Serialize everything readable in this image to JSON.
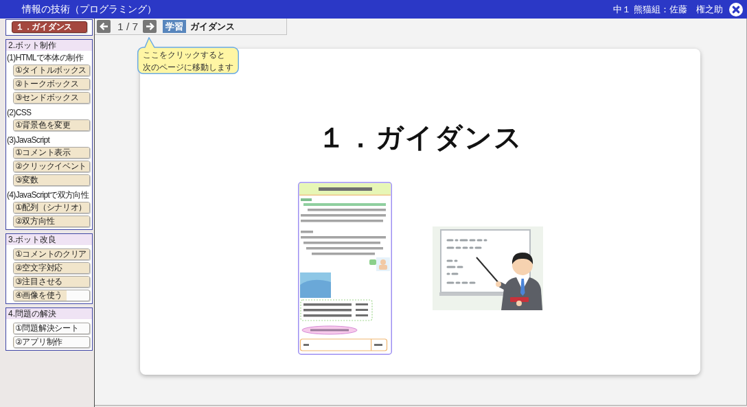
{
  "header": {
    "title": "情報の技術（プログラミング）",
    "user": "中１ 熊猫組：佐藤　権之助"
  },
  "sidebar": {
    "sections": [
      {
        "groups": [
          {
            "lessons": [
              {
                "label": "１．ガイダンス",
                "selected": true
              }
            ]
          }
        ]
      },
      {
        "title": "2.ボット制作",
        "groups": [
          {
            "label": "(1)HTMLで本体の制作",
            "lessons": [
              {
                "label": "①タイトルボックス",
                "selected": false,
                "level": 1
              },
              {
                "label": "②トークボックス",
                "selected": false,
                "level": 1
              },
              {
                "label": "③センドボックス",
                "selected": false,
                "level": 1
              }
            ]
          },
          {
            "label": "(2)CSS",
            "lessons": [
              {
                "label": "①背景色を変更",
                "selected": false,
                "level": 1
              }
            ]
          },
          {
            "label": "(3)JavaScript",
            "lessons": [
              {
                "label": "①コメント表示",
                "selected": false,
                "level": 1
              },
              {
                "label": "②クリックイベント",
                "selected": false,
                "level": 1
              },
              {
                "label": "③変数",
                "selected": false,
                "level": 1
              }
            ]
          },
          {
            "label": "(4)JavaScriptで双方向性",
            "lessons": [
              {
                "label": "①配列（シナリオ）",
                "selected": false,
                "level": 1
              },
              {
                "label": "②双方向性",
                "selected": false,
                "level": 1
              }
            ]
          }
        ]
      },
      {
        "title": "3.ボット改良",
        "groups": [
          {
            "lessons": [
              {
                "label": "①コメントのクリア",
                "selected": false,
                "level": 1
              },
              {
                "label": "②空文字対応",
                "selected": false,
                "level": 1
              },
              {
                "label": "③注目させる",
                "selected": false,
                "level": 1
              },
              {
                "label": "④画像を使う",
                "selected": false,
                "level": 0.7
              }
            ]
          }
        ]
      },
      {
        "title": "4.問題の解決",
        "groups": [
          {
            "lessons": [
              {
                "label": "①問題解決シート",
                "selected": false,
                "level": 0
              },
              {
                "label": "②アプリ制作",
                "selected": false,
                "level": 0
              }
            ]
          }
        ]
      }
    ]
  },
  "nav": {
    "page": "1 / 7",
    "tag": "学習",
    "title": "ガイダンス"
  },
  "tooltip": {
    "lines": [
      "ここをクリックすると",
      "次のページに移動します"
    ]
  },
  "slide": {
    "title": "１．ガイダンス"
  }
}
